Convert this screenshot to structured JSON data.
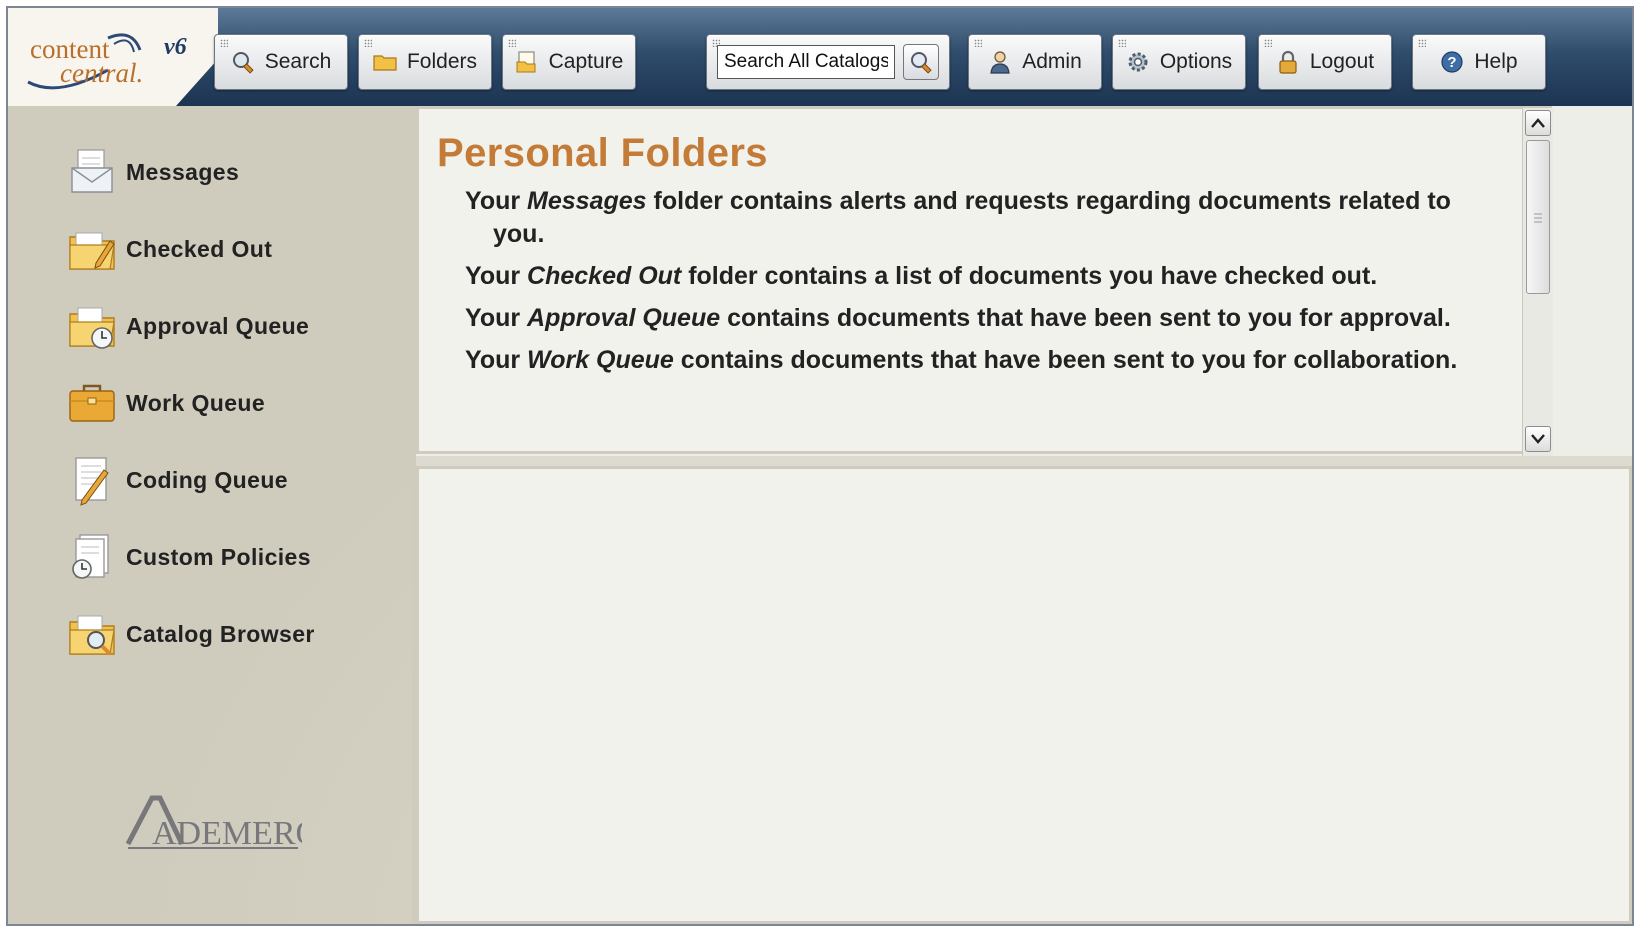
{
  "app": {
    "logo_top": "content",
    "logo_bottom": "central.",
    "version": "v6",
    "brand": "ADEMERO",
    "accent_color": "#c47b37"
  },
  "toolbar": {
    "buttons": [
      {
        "label": "Search",
        "icon": "magnifier-icon"
      },
      {
        "label": "Folders",
        "icon": "folder-icon"
      },
      {
        "label": "Capture",
        "icon": "capture-icon"
      },
      {
        "label": "Admin",
        "icon": "user-icon"
      },
      {
        "label": "Options",
        "icon": "gear-icon"
      },
      {
        "label": "Logout",
        "icon": "lock-icon"
      },
      {
        "label": "Help",
        "icon": "help-icon"
      }
    ],
    "search": {
      "value": "Search All Catalogs",
      "button_icon": "magnifier-icon"
    }
  },
  "sidebar": {
    "items": [
      {
        "label": "Messages",
        "icon": "envelope-icon"
      },
      {
        "label": "Checked Out",
        "icon": "folder-pencil-icon"
      },
      {
        "label": "Approval Queue",
        "icon": "folder-clock-icon"
      },
      {
        "label": "Work Queue",
        "icon": "briefcase-icon"
      },
      {
        "label": "Coding Queue",
        "icon": "document-pencil-icon"
      },
      {
        "label": "Custom Policies",
        "icon": "document-clock-icon"
      },
      {
        "label": "Catalog Browser",
        "icon": "folder-magnifier-icon"
      }
    ]
  },
  "main": {
    "title": "Personal Folders",
    "descriptions": [
      {
        "pre": "Your ",
        "em": "Messages",
        "post": " folder contains alerts and requests regarding documents related to you."
      },
      {
        "pre": "Your ",
        "em": "Checked Out",
        "post": " folder contains a list of documents you have checked out."
      },
      {
        "pre": "Your ",
        "em": "Approval Queue",
        "post": " contains documents that have been sent to you for approval."
      },
      {
        "pre": "Your ",
        "em": "Work Queue",
        "post": " contains documents that have been sent to you for collaboration."
      }
    ]
  }
}
